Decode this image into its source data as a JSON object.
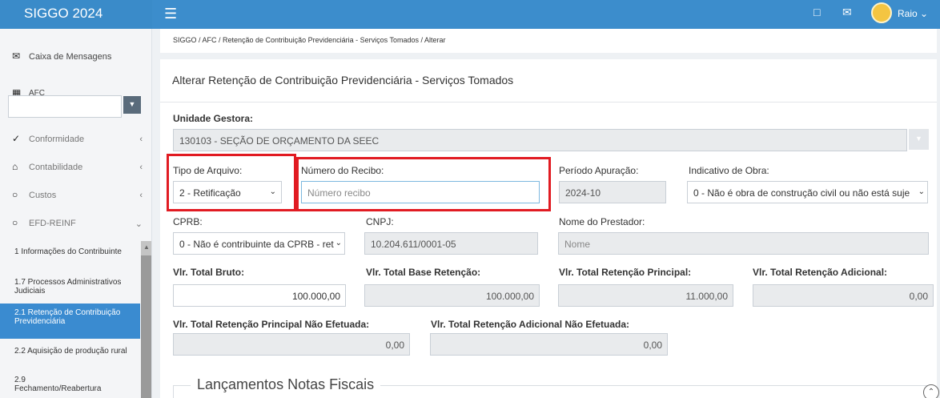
{
  "header": {
    "app_title": "SIGGO 2024",
    "menu_icon": "hamburger-icon",
    "chat_icon": "chat-icon",
    "mail_icon": "mail-icon",
    "user_name": "Raio"
  },
  "sidebar": {
    "messages_label": "Caixa de Mensagens",
    "afc_label": "AFC",
    "items": [
      {
        "icon": "check-icon",
        "label": "Conformidade"
      },
      {
        "icon": "bank-icon",
        "label": "Contabilidade"
      },
      {
        "icon": "circle-icon",
        "label": "Custos"
      },
      {
        "icon": "circle-icon",
        "label": "EFD-REINF"
      }
    ],
    "sub_items": [
      "1 Informações do Contribuinte",
      "1.7 Processos Administrativos Judiciais",
      "2.1 Retenção de Contribuição Previdenciária",
      "2.2 Aquisição de produção rural",
      "2.9 Fechamento/Reabertura"
    ]
  },
  "breadcrumb": {
    "text": "SIGGO  /  AFC  /  Retenção de Contribuição Previdenciária - Serviços Tomados  /  Alterar"
  },
  "form": {
    "title": "Alterar Retenção de Contribuição Previdenciária - Serviços Tomados",
    "unidade_label": "Unidade Gestora:",
    "unidade_value": "130103 - SEÇÃO DE ORÇAMENTO DA SEEC",
    "tipo_label": "Tipo de Arquivo:",
    "tipo_value": "2 - Retificação",
    "recibo_label": "Número do Recibo:",
    "recibo_placeholder": "Número recibo",
    "periodo_label": "Período Apuração:",
    "periodo_value": "2024-10",
    "obra_label": "Indicativo de Obra:",
    "obra_value": "0 - Não é obra de construção civil ou não está suje",
    "cprb_label": "CPRB:",
    "cprb_value": "0 - Não é contribuinte da CPRB - ret",
    "cnpj_label": "CNPJ:",
    "cnpj_value": "10.204.611/0001-05",
    "prestador_label": "Nome do Prestador:",
    "prestador_placeholder": "Nome",
    "bruto_label": "Vlr. Total Bruto:",
    "bruto_value": "100.000,00",
    "base_label": "Vlr. Total Base Retenção:",
    "base_value": "100.000,00",
    "principal_label": "Vlr. Total Retenção Principal:",
    "principal_value": "11.000,00",
    "adicional_label": "Vlr. Total Retenção Adicional:",
    "adicional_value": "0,00",
    "princ_nao_label": "Vlr. Total Retenção Principal Não Efetuada:",
    "princ_nao_value": "0,00",
    "adic_nao_label": "Vlr. Total Retenção Adicional Não Efetuada:",
    "adic_nao_value": "0,00",
    "section_title": "Lançamentos Notas Fiscais"
  },
  "colors": {
    "header_blue": "#3c8dcc",
    "active_item": "#3a8bd0",
    "highlight_red": "#e11b22"
  }
}
